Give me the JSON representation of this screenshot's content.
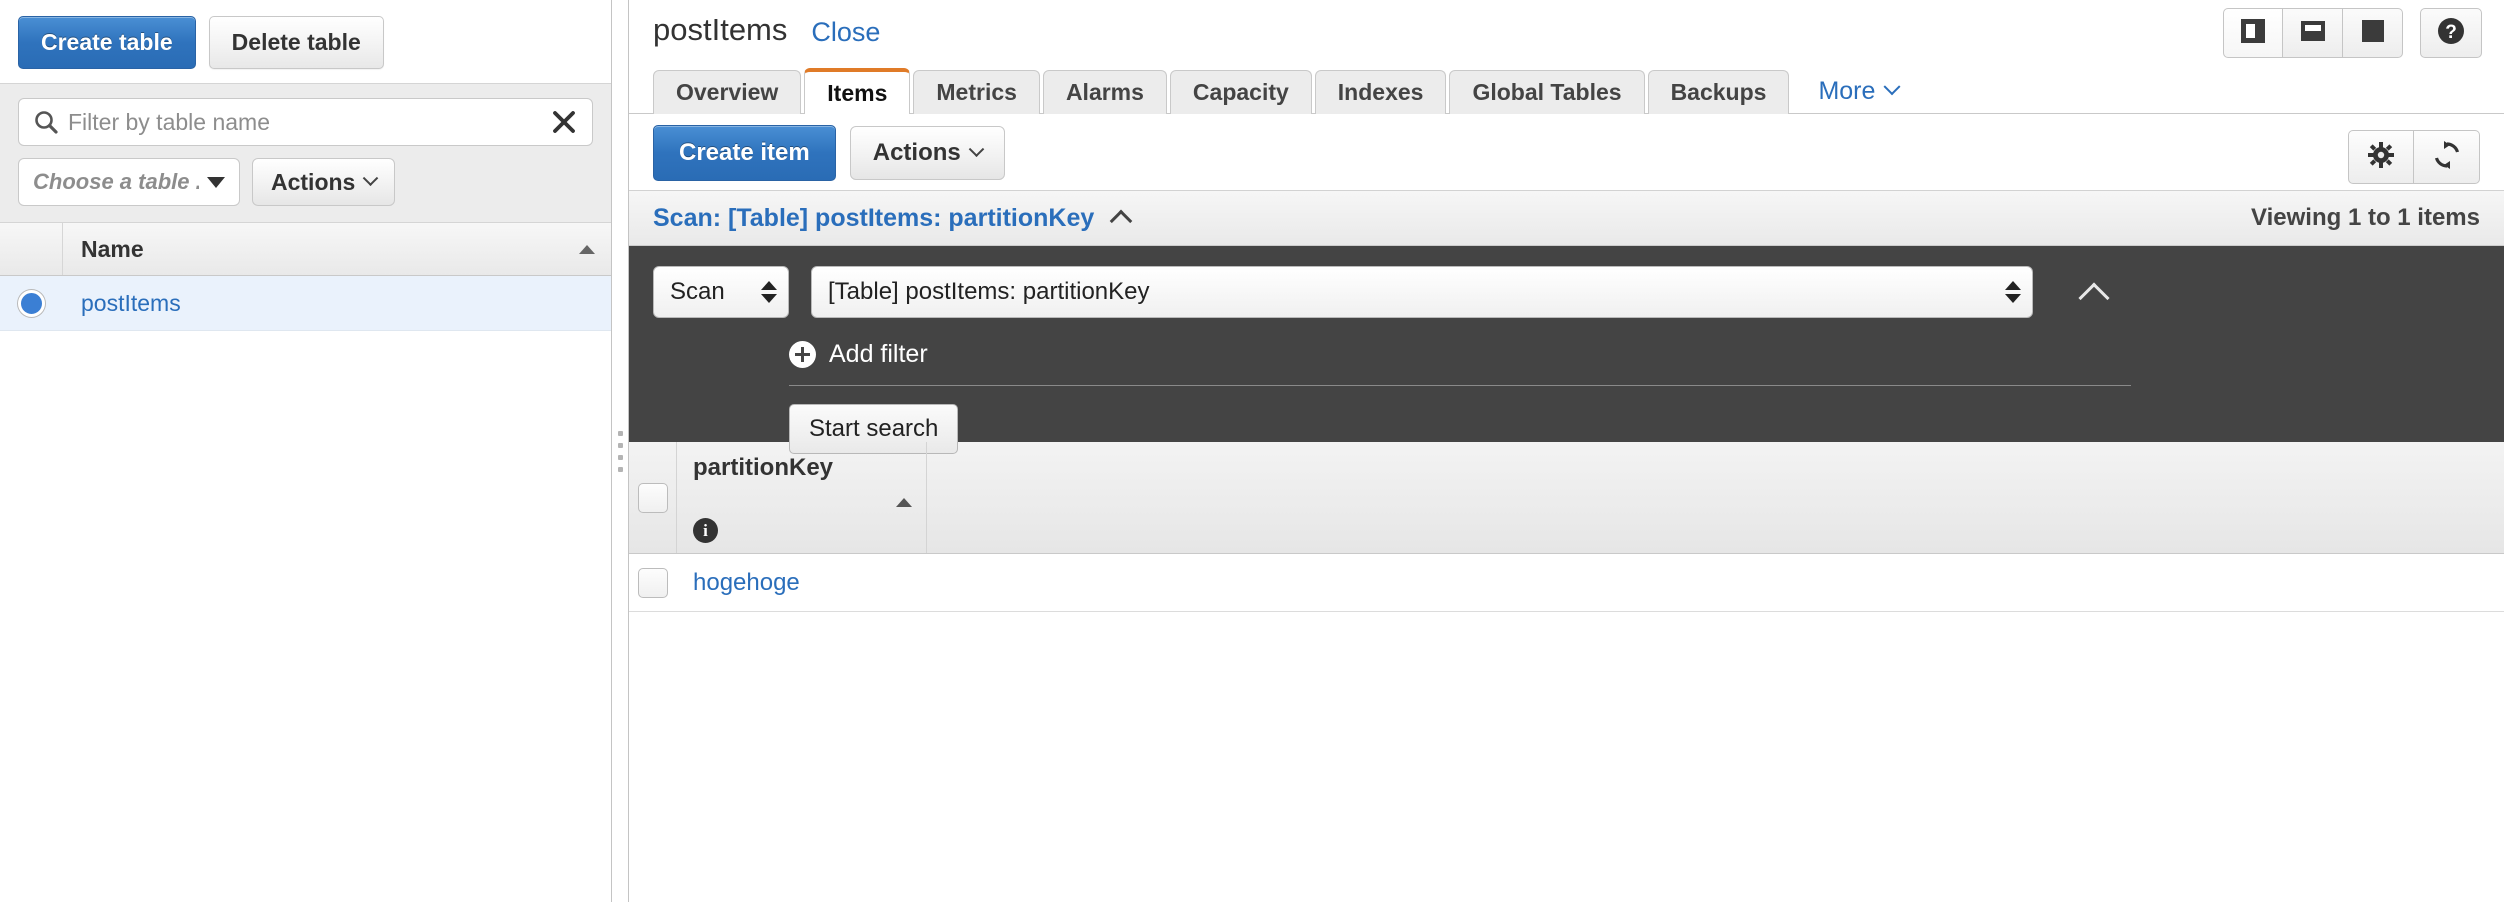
{
  "left": {
    "create_table_label": "Create table",
    "delete_table_label": "Delete table",
    "filter_placeholder": "Filter by table name",
    "filter_value": "",
    "choose_table_label": "Choose a table ...",
    "actions_label": "Actions",
    "name_column_header": "Name",
    "tables": [
      {
        "name": "postItems",
        "selected": true
      }
    ]
  },
  "right": {
    "title": "postItems",
    "close_label": "Close",
    "layout_buttons": [
      {
        "icon": "split-vertical-icon",
        "active": true
      },
      {
        "icon": "split-horizontal-icon",
        "active": false
      },
      {
        "icon": "full-panel-icon",
        "active": false
      }
    ],
    "help_icon": "help-question-icon",
    "tabs": [
      {
        "label": "Overview",
        "active": false
      },
      {
        "label": "Items",
        "active": true
      },
      {
        "label": "Metrics",
        "active": false
      },
      {
        "label": "Alarms",
        "active": false
      },
      {
        "label": "Capacity",
        "active": false
      },
      {
        "label": "Indexes",
        "active": false
      },
      {
        "label": "Global Tables",
        "active": false
      },
      {
        "label": "Backups",
        "active": false
      }
    ],
    "more_label": "More",
    "toolbar": {
      "create_item_label": "Create item",
      "actions_label": "Actions",
      "settings_icon": "gear-icon",
      "refresh_icon": "refresh-icon"
    },
    "scan_bar": {
      "title": "Scan: [Table] postItems: partitionKey",
      "viewing_text": "Viewing 1 to 1 items",
      "collapse_icon": "chevron-up-icon"
    },
    "scan_panel": {
      "operation_value": "Scan",
      "index_value": "[Table] postItems: partitionKey",
      "add_filter_label": "Add filter",
      "start_search_label": "Start search",
      "collapse_icon": "chevron-up-icon"
    },
    "results": {
      "columns": [
        {
          "label": "partitionKey",
          "sort": "asc",
          "info": "i"
        }
      ],
      "rows": [
        {
          "partitionKey": "hogehoge",
          "checked": false
        }
      ]
    }
  },
  "colors": {
    "primary_blue": "#2f73bd",
    "link_blue": "#2a6ebb",
    "active_tab_orange": "#e07b28",
    "dark_panel": "#444444",
    "selected_row": "#eaf2fc"
  }
}
